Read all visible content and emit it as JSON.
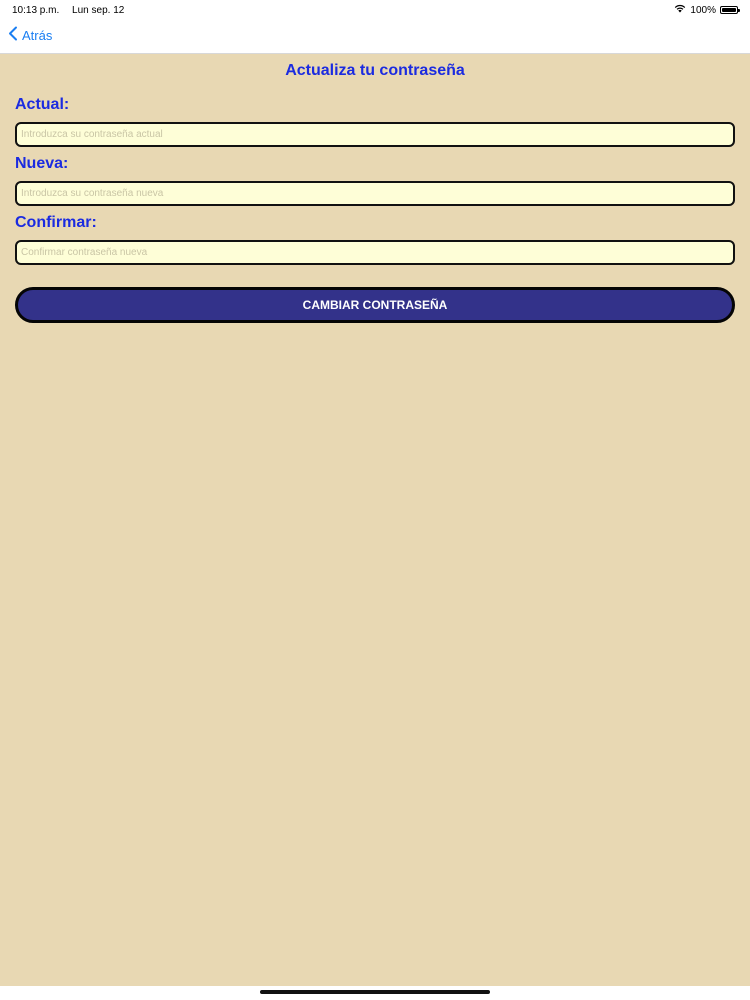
{
  "status_bar": {
    "time": "10:13 p.m.",
    "date": "Lun sep. 12",
    "battery": "100%",
    "battery_level": 1.0
  },
  "nav": {
    "back_label": "Atrás"
  },
  "form": {
    "title": "Actualiza tu contraseña",
    "current": {
      "label": "Actual:",
      "placeholder": "Introduzca su contraseña actual",
      "value": ""
    },
    "new": {
      "label": "Nueva:",
      "placeholder": "Introduzca su contraseña nueva",
      "value": ""
    },
    "confirm": {
      "label": "Confirmar:",
      "placeholder": "Confirmar contraseña nueva",
      "value": ""
    },
    "submit_label": "CAMBIAR CONTRASEÑA"
  },
  "colors": {
    "background": "#e8d8b3",
    "label": "#1b2be0",
    "input_background": "#fefed7",
    "button_background": "#33328a",
    "link": "#1a7ef2"
  },
  "icons": {
    "back": "chevron-left-icon",
    "wifi": "wifi-icon",
    "battery": "battery-icon"
  }
}
